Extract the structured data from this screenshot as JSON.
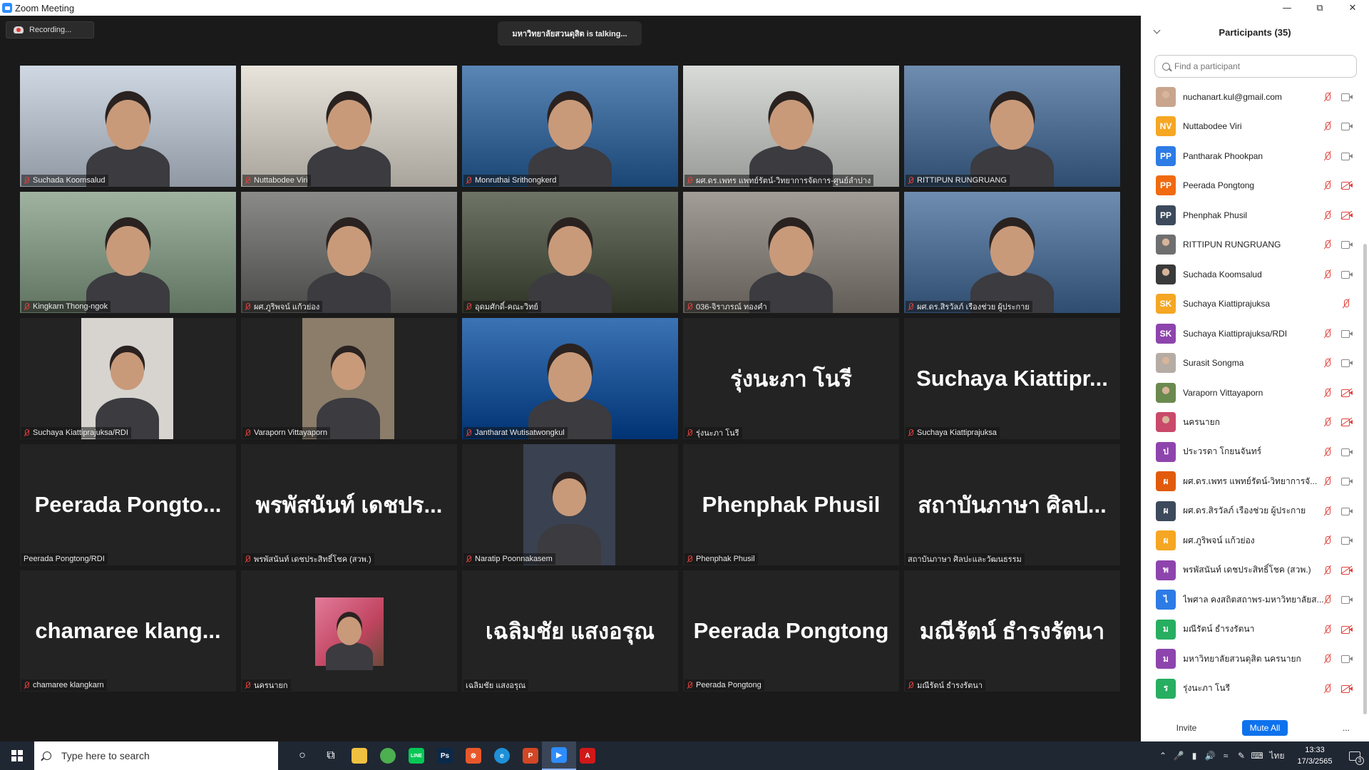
{
  "window": {
    "title": "Zoom Meeting"
  },
  "meeting": {
    "recording_label": "Recording...",
    "talking_label": "มหาวิทยาลัยสวนดุสิต is talking..."
  },
  "tiles": [
    {
      "name": "Suchada Koomsalud",
      "muted": true,
      "video": true,
      "bg": "#cfd8e3"
    },
    {
      "name": "Nuttabodee Viri",
      "muted": true,
      "video": true,
      "bg": "#e8e4dc"
    },
    {
      "name": "Monruthai Srithongkerd",
      "muted": true,
      "video": true,
      "bg": "#5a86b6"
    },
    {
      "name": "ผศ.ดร.เพทร แพทย์รัตน์-วิทยาการจัดการ-ศูนย์ลำปาง",
      "muted": true,
      "video": true,
      "bg": "#d9dbd8"
    },
    {
      "name": "RITTIPUN RUNGRUANG",
      "muted": true,
      "video": true,
      "bg": "#6f8db0"
    },
    {
      "name": "Kingkarn Thong-ngok",
      "muted": true,
      "video": true,
      "bg": "#9fb3a0"
    },
    {
      "name": "ผศ.ภูริพจน์ แก้วย่อง",
      "muted": true,
      "video": true,
      "bg": "#8a8a88"
    },
    {
      "name": "อุดมศักดิ์-คณะวิทย์",
      "muted": true,
      "video": true,
      "bg": "#6e7466"
    },
    {
      "name": "036-จิราภรณ์ ทองคำ",
      "muted": true,
      "video": true,
      "bg": "#a39d97"
    },
    {
      "name": "ผศ.ดร.สิรวัลภ์ เรืองช่วย ผู้ประกาย",
      "muted": true,
      "video": true,
      "bg": "#6f8db0"
    },
    {
      "name": "Suchaya Kiattiprajuksa/RDI",
      "muted": true,
      "video": true,
      "bg": "#d7d4cf",
      "narrow": true
    },
    {
      "name": "Varaporn Vittayaporn",
      "muted": true,
      "video": true,
      "bg": "#8b7d6a",
      "narrow": true
    },
    {
      "name": "Jantharat Wutisatwongkul",
      "muted": true,
      "video": true,
      "bg": "#3b73b4"
    },
    {
      "name": "รุ่งนะภา โนรี",
      "muted": true,
      "video": false,
      "big": "รุ่งนะภา โนรี"
    },
    {
      "name": "Suchaya Kiattiprajuksa",
      "muted": true,
      "video": false,
      "big": "Suchaya  Kiattipr..."
    },
    {
      "name": "Peerada Pongtong/RDI",
      "muted": false,
      "video": false,
      "big": "Peerada  Pongto..."
    },
    {
      "name": "พรพัสนันท์ เดชประสิทธิ์โชค (สวพ.)",
      "muted": true,
      "video": false,
      "big": "พรพัสนันท์ เดชปร..."
    },
    {
      "name": "Naratip Poonnakasem",
      "muted": true,
      "video": true,
      "bg": "#3a4150",
      "narrow": true
    },
    {
      "name": "Phenphak Phusil",
      "muted": true,
      "video": false,
      "big": "Phenphak Phusil"
    },
    {
      "name": "สถาบันภาษา ศิลปะและวัฒนธรรม",
      "muted": false,
      "video": false,
      "big": "สถาบันภาษา ศิลป..."
    },
    {
      "name": "chamaree klangkarn",
      "muted": true,
      "video": false,
      "big": "chamaree  klang..."
    },
    {
      "name": "นครนายก",
      "muted": true,
      "video": false,
      "thumb": true
    },
    {
      "name": "เฉลิมชัย แสงอรุณ",
      "muted": false,
      "video": false,
      "big": "เฉลิมชัย แสงอรุณ"
    },
    {
      "name": "Peerada Pongtong",
      "muted": true,
      "video": false,
      "big": "Peerada Pongtong"
    },
    {
      "name": "มณีรัตน์ ธำรงรัตนา",
      "muted": true,
      "video": false,
      "big": "มณีรัตน์ ธำรงรัตนา"
    }
  ],
  "participants": {
    "title": "Participants (35)",
    "search_placeholder": "Find a participant",
    "list": [
      {
        "name": "nuchanart.kul@gmail.com",
        "initials": "",
        "color": "#c9a58e",
        "photo": true,
        "cam_off": false
      },
      {
        "name": "Nuttabodee Viri",
        "initials": "NV",
        "color": "#f5a623",
        "photo": false,
        "cam_off": false
      },
      {
        "name": "Pantharak Phookpan",
        "initials": "PP",
        "color": "#2d7be5",
        "photo": false,
        "cam_off": false
      },
      {
        "name": "Peerada Pongtong",
        "initials": "PP",
        "color": "#f06a0f",
        "photo": false,
        "cam_off": true
      },
      {
        "name": "Phenphak Phusil",
        "initials": "PP",
        "color": "#3d4a5c",
        "photo": false,
        "cam_off": true
      },
      {
        "name": "RITTIPUN RUNGRUANG",
        "initials": "",
        "color": "#6f6f6f",
        "photo": true,
        "cam_off": false
      },
      {
        "name": "Suchada Koomsalud",
        "initials": "",
        "color": "#3a3a3a",
        "photo": true,
        "cam_off": false
      },
      {
        "name": "Suchaya Kiattiprajuksa",
        "initials": "SK",
        "color": "#f5a623",
        "photo": false,
        "cam_off": null
      },
      {
        "name": "Suchaya Kiattiprajuksa/RDI",
        "initials": "SK",
        "color": "#8e44ad",
        "photo": false,
        "cam_off": false
      },
      {
        "name": "Surasit Songma",
        "initials": "",
        "color": "#b5aca4",
        "photo": true,
        "cam_off": false
      },
      {
        "name": "Varaporn Vittayaporn",
        "initials": "",
        "color": "#6b8a4f",
        "photo": true,
        "cam_off": true
      },
      {
        "name": "นครนายก",
        "initials": "",
        "color": "#c94a6a",
        "photo": true,
        "cam_off": true
      },
      {
        "name": "ประวรดา โกยนจันทร์",
        "initials": "ป",
        "color": "#8e44ad",
        "photo": false,
        "cam_off": false
      },
      {
        "name": "ผศ.ดร.เพทร แพทย์รัตน์-วิทยาการจั...",
        "initials": "ผ",
        "color": "#e25a0c",
        "photo": false,
        "cam_off": false
      },
      {
        "name": "ผศ.ดร.สิรวัลภ์ เรืองช่วย ผู้ประกาย",
        "initials": "ผ",
        "color": "#3d4a5c",
        "photo": false,
        "cam_off": false
      },
      {
        "name": "ผศ.ภูริพจน์ แก้วย่อง",
        "initials": "ผ",
        "color": "#f5a623",
        "photo": false,
        "cam_off": false
      },
      {
        "name": "พรพัสนันท์ เดชประสิทธิ์โชค (สวพ.)",
        "initials": "พ",
        "color": "#8e44ad",
        "photo": false,
        "cam_off": true
      },
      {
        "name": "ไพศาล คงสถิตสถาพร-มหาวิทยาลัยส...",
        "initials": "ไ",
        "color": "#2d7be5",
        "photo": false,
        "cam_off": false
      },
      {
        "name": "มณีรัตน์ ธำรงรัตนา",
        "initials": "ม",
        "color": "#27ae60",
        "photo": false,
        "cam_off": true
      },
      {
        "name": "มหาวิทยาลัยสวนดุสิต นครนายก",
        "initials": "ม",
        "color": "#8e44ad",
        "photo": false,
        "cam_off": false
      },
      {
        "name": "รุ่งนะภา โนรี",
        "initials": "ร",
        "color": "#27ae60",
        "photo": false,
        "cam_off": true
      }
    ],
    "invite_label": "Invite",
    "mute_all_label": "Mute All",
    "more_label": "..."
  },
  "taskbar": {
    "search_placeholder": "Type here to search",
    "apps": [
      {
        "name": "cortana",
        "glyph": "○",
        "color": "transparent"
      },
      {
        "name": "task-view",
        "glyph": "⧉",
        "color": "transparent"
      },
      {
        "name": "file-explorer",
        "glyph": "",
        "color": "#f0c040"
      },
      {
        "name": "chrome",
        "glyph": "",
        "color": "#4caf50"
      },
      {
        "name": "line",
        "glyph": "LINE",
        "color": "#06c755"
      },
      {
        "name": "photoshop",
        "glyph": "Ps",
        "color": "#0b2a4a"
      },
      {
        "name": "app-orange",
        "glyph": "⊗",
        "color": "#e8572a"
      },
      {
        "name": "edge",
        "glyph": "e",
        "color": "#1e90d8"
      },
      {
        "name": "powerpoint",
        "glyph": "P",
        "color": "#d24726"
      },
      {
        "name": "zoom",
        "glyph": "▶",
        "color": "#2d8cff"
      },
      {
        "name": "acrobat",
        "glyph": "A",
        "color": "#d01818"
      }
    ],
    "language": "ไทย",
    "time": "13:33",
    "date": "17/3/2565",
    "notifications": "3"
  }
}
